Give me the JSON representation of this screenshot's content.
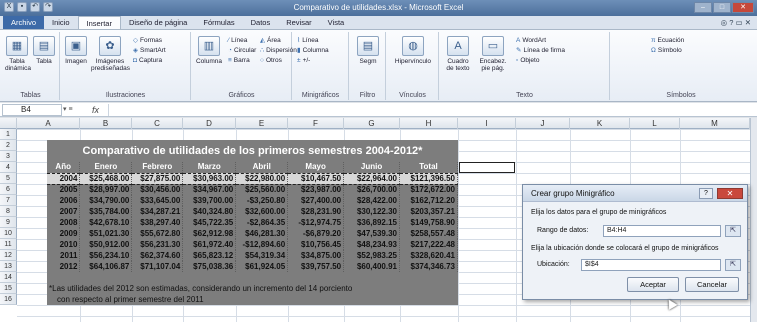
{
  "window": {
    "title": "Comparativo de utilidades.xlsx - Microsoft Excel",
    "controls": [
      "–",
      "□",
      "✕"
    ]
  },
  "tabs": [
    "Archivo",
    "Inicio",
    "Insertar",
    "Diseño de página",
    "Fórmulas",
    "Datos",
    "Revisar",
    "Vista"
  ],
  "ribbon": {
    "groups": {
      "tablas": "Tablas",
      "ilustraciones": "Ilustraciones",
      "graficos": "Gráficos",
      "minigraficos": "Minigráficos",
      "filtro": "Filtro",
      "vinculos": "Vínculos",
      "texto": "Texto",
      "simbolos": "Símbolos"
    },
    "tabla_dinamica": "Tabla dinámica",
    "tabla": "Tabla",
    "imagen": "Imagen",
    "imagenes_predisenadas": "Imágenes prediseñadas",
    "formas": "Formas",
    "smartart": "SmartArt",
    "captura": "Captura",
    "columna": "Columna",
    "linea": "Línea",
    "circular": "Circular",
    "barra": "Barra",
    "area": "Área",
    "dispersion": "Dispersión",
    "otros": "Otros",
    "mini_linea": "Línea",
    "mini_columna": "Columna",
    "mini_gp": "+/-",
    "segm": "Segm",
    "hipervinculo": "Hipervínculo",
    "cuadro_texto": "Cuadro de texto",
    "encabezado": "Encabez. pie pág.",
    "wordart": "WordArt",
    "linea_firma": "Línea de firma",
    "objeto": "Objeto",
    "ecuacion": "Ecuación",
    "simbolo": "Símbolo"
  },
  "formula_bar": {
    "name_box": "B4",
    "fx": "fx",
    "value": ""
  },
  "columns": [
    "A",
    "B",
    "C",
    "D",
    "E",
    "F",
    "G",
    "H",
    "I",
    "J",
    "K",
    "L",
    "M"
  ],
  "rows": [
    "1",
    "2",
    "3",
    "4",
    "5",
    "6",
    "7",
    "8",
    "9",
    "10",
    "11",
    "12",
    "13",
    "14",
    "15",
    "16"
  ],
  "table": {
    "title": "Comparativo de utilidades de los primeros semestres 2004-2012*",
    "headers": [
      "Año",
      "Enero",
      "Febrero",
      "Marzo",
      "Abril",
      "Mayo",
      "Junio",
      "Total"
    ],
    "rows": [
      [
        "2004",
        "$25,468.00",
        "$27,875.00",
        "$30,963.00",
        "$22,980.00",
        "$10,467.50",
        "$22,964.00",
        "$121,396.50"
      ],
      [
        "2005",
        "$28,997.00",
        "$30,456.00",
        "$34,967.00",
        "$25,560.00",
        "$23,987.00",
        "$26,700.00",
        "$172,672.00"
      ],
      [
        "2006",
        "$34,790.00",
        "$33,645.00",
        "$39,700.00",
        "-$3,250.80",
        "$27,400.00",
        "$28,422.00",
        "$162,712.20"
      ],
      [
        "2007",
        "$35,784.00",
        "$34,287.21",
        "$40,324.80",
        "$32,600.00",
        "$28,231.90",
        "$30,122.30",
        "$203,357.21"
      ],
      [
        "2008",
        "$42,678.10",
        "$38,297.40",
        "$45,722.35",
        "-$2,864.35",
        "-$12,974.75",
        "$36,892.15",
        "$149,758.90"
      ],
      [
        "2009",
        "$51,021.30",
        "$55,672.80",
        "$62,912.98",
        "$46,281.30",
        "-$6,879.20",
        "$47,539.30",
        "$258,557.48"
      ],
      [
        "2010",
        "$50,912.00",
        "$56,231.30",
        "$61,972.40",
        "-$12,894.60",
        "$10,756.45",
        "$48,234.93",
        "$217,222.48"
      ],
      [
        "2011",
        "$56,234.10",
        "$62,374.60",
        "$65,823.12",
        "$54,319.34",
        "$34,875.00",
        "$52,983.25",
        "$328,620.41"
      ],
      [
        "2012",
        "$64,106.87",
        "$71,107.04",
        "$75,038.36",
        "$61,924.05",
        "$39,757.50",
        "$60,400.91",
        "$374,346.73"
      ]
    ],
    "note1": "*Las utilidades del 2012 son estimadas, considerando un incremento del 14 porciento",
    "note2": "con respecto al primer semestre del 2011"
  },
  "dialog": {
    "title": "Crear grupo Minigráfico",
    "help": "?",
    "close": "✕",
    "section1": "Elija los datos para el grupo de minigráficos",
    "range_label": "Rango de datos:",
    "range_value": "B4:H4",
    "section2": "Elija la ubicación donde se colocará el grupo de minigráficos",
    "location_label": "Ubicación:",
    "location_value": "$I$4",
    "ok": "Aceptar",
    "cancel": "Cancelar"
  }
}
